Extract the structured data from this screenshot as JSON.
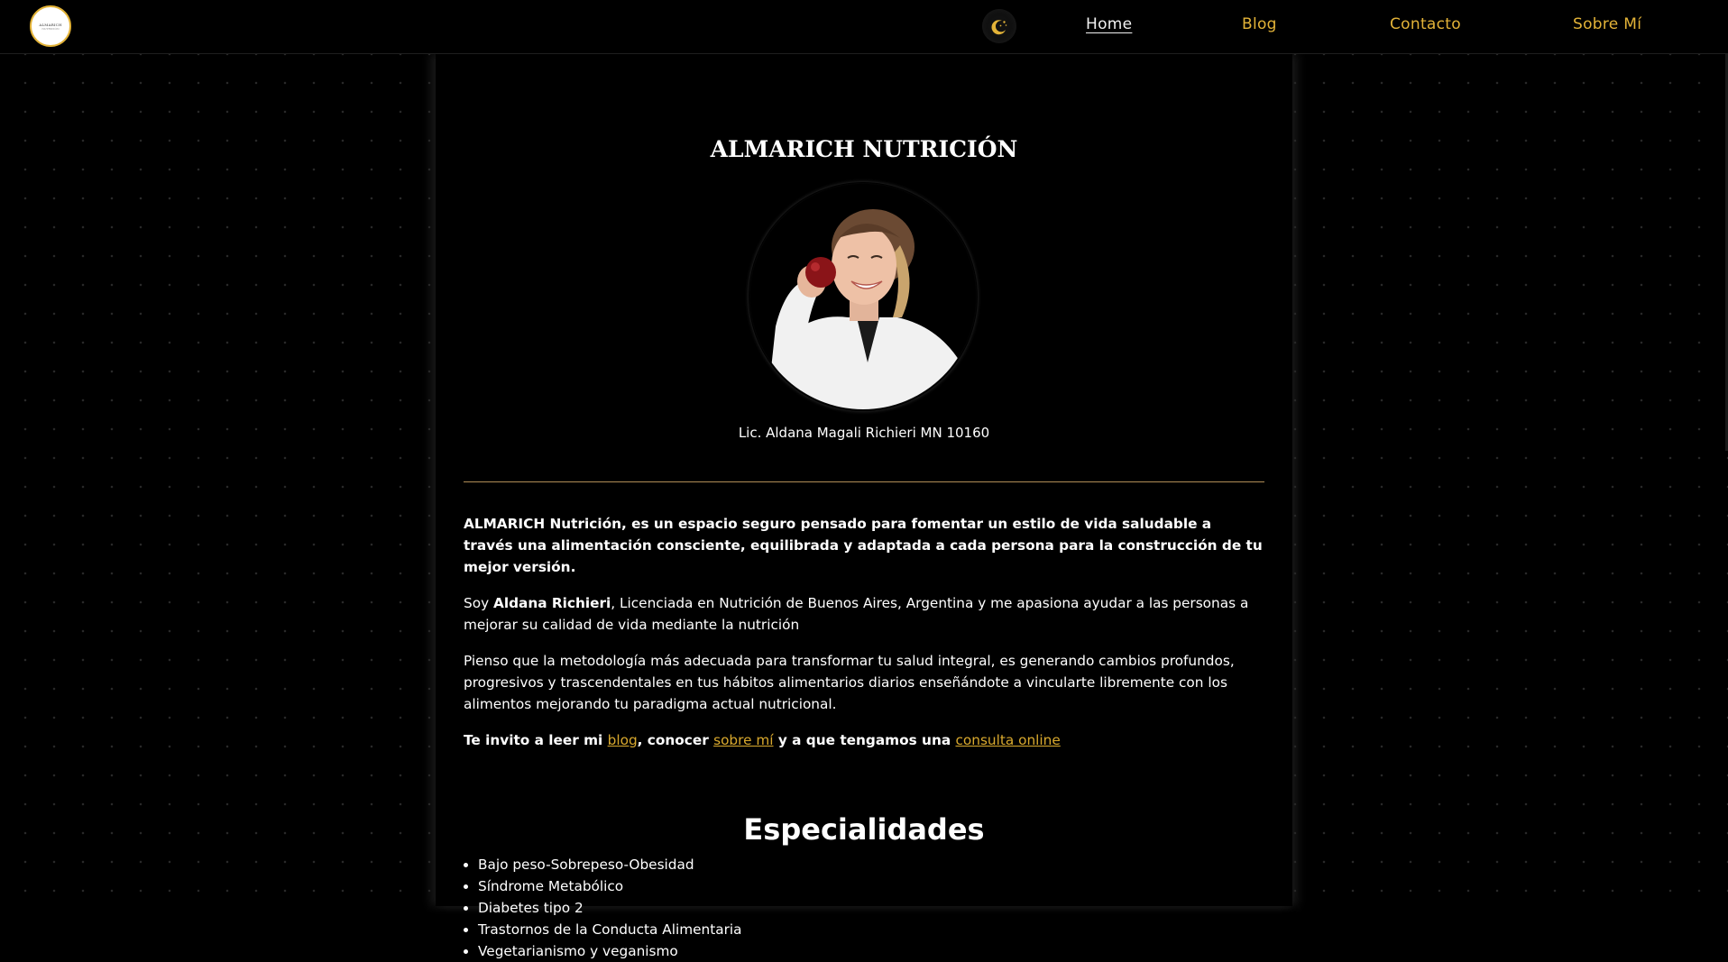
{
  "header": {
    "logo_line1": "ALMARICH",
    "logo_line2": "NUTRICIÓN",
    "nav": [
      {
        "label": "Home",
        "active": true
      },
      {
        "label": "Blog",
        "active": false
      },
      {
        "label": "Contacto",
        "active": false
      },
      {
        "label": "Sobre Mí",
        "active": false
      }
    ]
  },
  "main": {
    "title": "ALMARICH NUTRICIÓN",
    "caption": "Lic. Aldana Magali Richieri MN 10160",
    "intro": "ALMARICH Nutrición, es un espacio seguro pensado para fomentar un estilo de vida saludable a través una alimentación consciente, equilibrada y adaptada a cada persona para la construcción de tu mejor versión.",
    "about_prefix": "Soy ",
    "about_name": "Aldana Richieri",
    "about_suffix": ", Licenciada en Nutrición de Buenos Aires, Argentina y me apasiona ayudar a las personas a mejorar su calidad de vida mediante la nutrición",
    "method": "Pienso que la metodología más adecuada para transformar tu salud integral, es generando cambios profundos, progresivos y trascendentales en tus hábitos alimentarios diarios enseñándote a vincularte libremente con los alimentos mejorando tu paradigma actual nutricional.",
    "invite_1": "Te invito a leer mi ",
    "invite_link_blog": "blog",
    "invite_2": ", conocer ",
    "invite_link_about": "sobre mí",
    "invite_3": " y a que tengamos una ",
    "invite_link_consult": "consulta online",
    "specialties_title": "Especialidades",
    "specialties": [
      "Bajo peso-Sobrepeso-Obesidad",
      "Síndrome Metabólico",
      "Diabetes tipo 2",
      "Trastornos de la Conducta Alimentaria",
      "Vegetarianismo y veganismo"
    ]
  },
  "colors": {
    "accent": "#e3b338",
    "link": "#d9a92e",
    "divider": "#b08d57",
    "background": "#000000"
  },
  "icons": {
    "theme_toggle": "moon-stars-icon"
  }
}
